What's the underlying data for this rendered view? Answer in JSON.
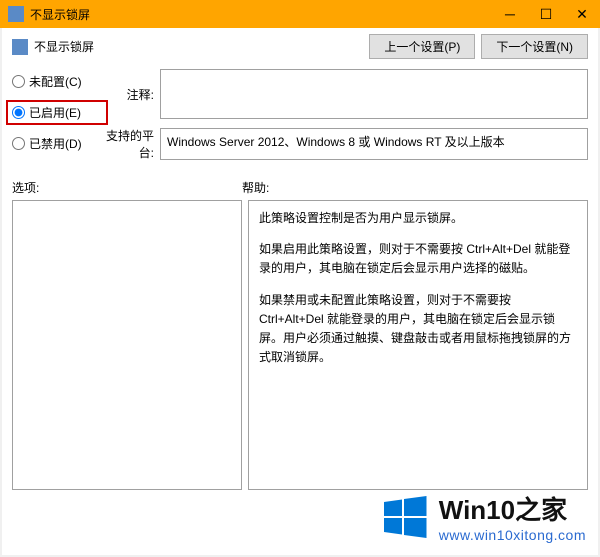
{
  "window": {
    "title": "不显示锁屏"
  },
  "header": {
    "title": "不显示锁屏",
    "prev_setting_label": "上一个设置(P)",
    "next_setting_label": "下一个设置(N)"
  },
  "radios": {
    "not_configured": "未配置(C)",
    "enabled": "已启用(E)",
    "disabled": "已禁用(D)"
  },
  "fields": {
    "comment_label": "注释:",
    "comment_value": "",
    "platform_label": "支持的平台:",
    "platform_value": "Windows Server 2012、Windows 8 或 Windows RT 及以上版本"
  },
  "sections": {
    "options_label": "选项:",
    "help_label": "帮助:"
  },
  "help": {
    "p1": "此策略设置控制是否为用户显示锁屏。",
    "p2": "如果启用此策略设置，则对于不需要按 Ctrl+Alt+Del 就能登录的用户，其电脑在锁定后会显示用户选择的磁贴。",
    "p3": "如果禁用或未配置此策略设置，则对于不需要按 Ctrl+Alt+Del 就能登录的用户，其电脑在锁定后会显示锁屏。用户必须通过触摸、键盘敲击或者用鼠标拖拽锁屏的方式取消锁屏。"
  },
  "watermark": {
    "big": "Win10",
    "suffix": "之家",
    "url": "www.win10xitong.com"
  }
}
